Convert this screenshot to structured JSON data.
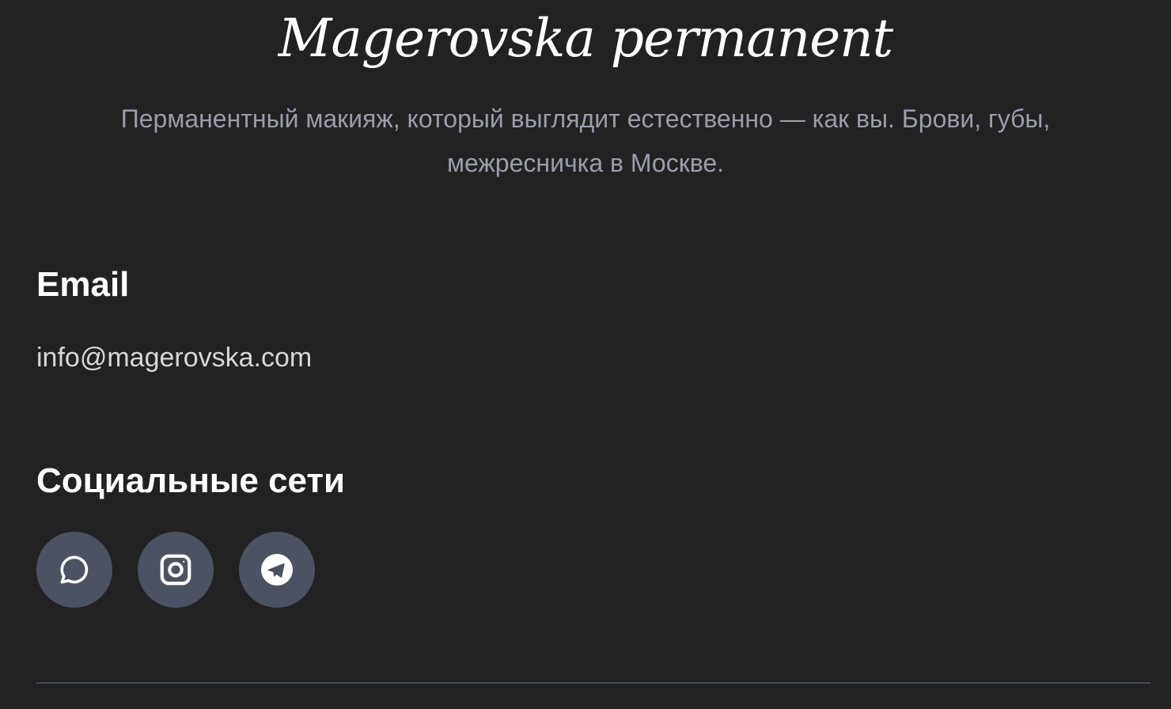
{
  "brand": {
    "name": "Magerovska permanent",
    "tagline": "Перманентный макияж, который выглядит естественно — как вы. Брови, губы, межресничка в Москве."
  },
  "contact": {
    "email_heading": "Email",
    "email": "info@magerovska.com"
  },
  "social": {
    "heading": "Социальные сети",
    "links": [
      {
        "icon": "chat-bubble-icon"
      },
      {
        "icon": "instagram-icon"
      },
      {
        "icon": "telegram-icon"
      }
    ]
  },
  "colors": {
    "background": "#222223",
    "text": "#ffffff",
    "muted_text": "#9a9eaa",
    "social_button": "#4c5261",
    "divider": "#434956"
  }
}
